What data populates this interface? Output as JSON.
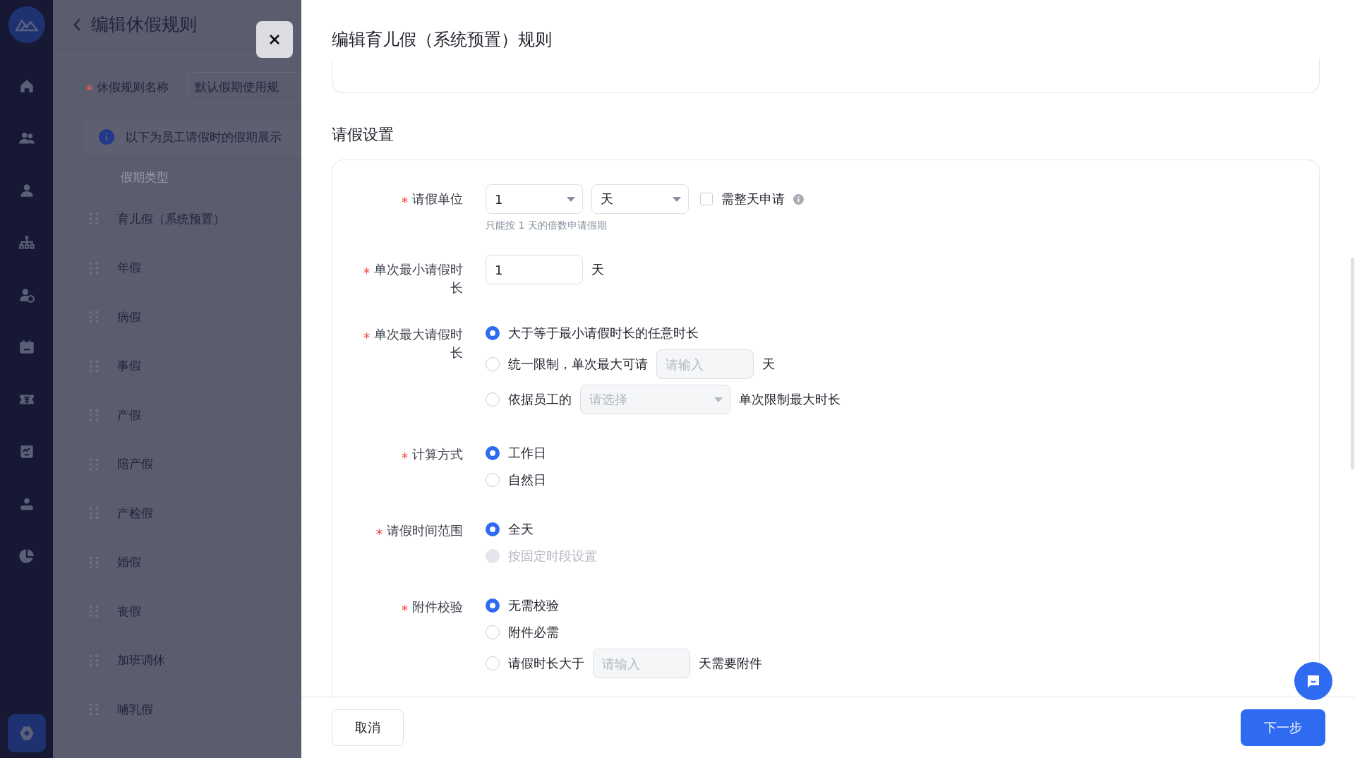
{
  "nav": {
    "items": [
      {
        "selected": false
      },
      {
        "selected": false
      },
      {
        "selected": false
      },
      {
        "selected": false
      },
      {
        "selected": false
      },
      {
        "selected": false
      },
      {
        "selected": false
      },
      {
        "selected": false
      },
      {
        "selected": false
      },
      {
        "selected": false
      }
    ],
    "bottom": [
      {
        "selected": true
      }
    ]
  },
  "background_page": {
    "title": "编辑休假规则",
    "name_label": "休假规则名称",
    "name_value": "默认假期使用规",
    "info": "以下为员工请假时的假期展示",
    "column_header": "假期类型",
    "leave_types": [
      "育儿假（系统预置）",
      "年假",
      "病假",
      "事假",
      "产假",
      "陪产假",
      "产检假",
      "婚假",
      "丧假",
      "加班调休",
      "哺乳假"
    ]
  },
  "drawer": {
    "title": "编辑育儿假（系统预置）规则",
    "section_title": "请假设置",
    "fields": [
      {
        "kind": "unit",
        "label": "请假单位",
        "required": true,
        "number": "1",
        "unit": "天",
        "checkbox": {
          "label": "需整天申请",
          "checked": false
        },
        "hint": "只能按 1 天的倍数申请假期"
      },
      {
        "kind": "number",
        "label": "单次最小请假时长",
        "required": true,
        "value": "1",
        "suffix": "天"
      },
      {
        "kind": "radios",
        "label": "单次最大请假时长",
        "required": true,
        "options": [
          {
            "kind": "plain",
            "label": "大于等于最小请假时长的任意时长",
            "selected": true,
            "disabled": false
          },
          {
            "kind": "input",
            "label": "统一限制，单次最大可请",
            "selected": false,
            "disabled": false,
            "placeholder": "请输入",
            "suffix": "天"
          },
          {
            "kind": "select",
            "label": "依据员工的",
            "selected": false,
            "disabled": false,
            "placeholder": "请选择",
            "suffix": "单次限制最大时长"
          }
        ]
      },
      {
        "kind": "radios",
        "label": "计算方式",
        "required": true,
        "options": [
          {
            "kind": "plain",
            "label": "工作日",
            "selected": true,
            "disabled": false
          },
          {
            "kind": "plain",
            "label": "自然日",
            "selected": false,
            "disabled": false
          }
        ]
      },
      {
        "kind": "radios",
        "label": "请假时间范围",
        "required": true,
        "options": [
          {
            "kind": "plain",
            "label": "全天",
            "selected": true,
            "disabled": false
          },
          {
            "kind": "plain",
            "label": "按固定时段设置",
            "selected": false,
            "disabled": true
          }
        ]
      },
      {
        "kind": "radios",
        "label": "附件校验",
        "required": true,
        "options": [
          {
            "kind": "plain",
            "label": "无需校验",
            "selected": true,
            "disabled": false
          },
          {
            "kind": "plain",
            "label": "附件必需",
            "selected": false,
            "disabled": false
          },
          {
            "kind": "input",
            "label": "请假时长大于",
            "selected": false,
            "disabled": false,
            "placeholder": "请输入",
            "suffix": "天需要附件"
          }
        ]
      }
    ],
    "buttons": {
      "cancel": "取消",
      "next": "下一步"
    }
  }
}
